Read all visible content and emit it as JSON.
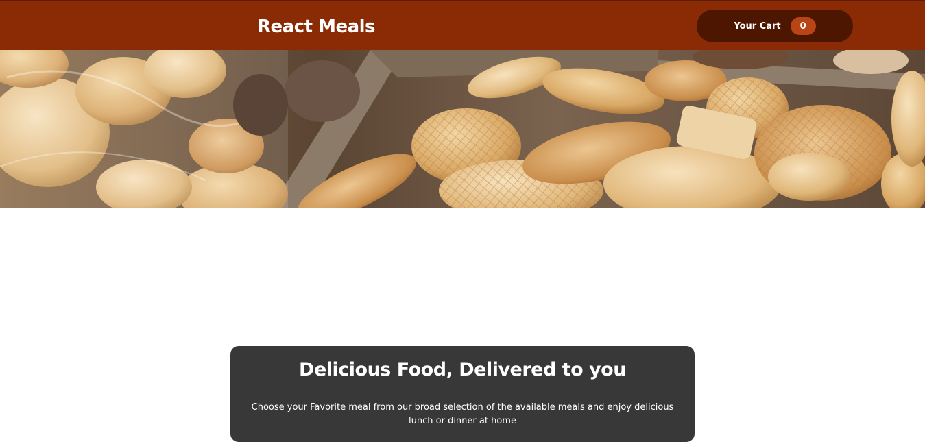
{
  "header": {
    "title": "React Meals",
    "cart_label": "Your Cart",
    "cart_count": "0"
  },
  "hero": {
    "image_icon": "cookies-image"
  },
  "summary": {
    "title": "Delicious Food, Delivered to you",
    "text": "Choose your Favorite meal from our broad selection of the available meals and enjoy delicious lunch or dinner at home"
  },
  "colors": {
    "header_bg": "#8a2b06",
    "cart_button_bg": "#4d1601",
    "badge_bg": "#b94517",
    "summary_bg": "#383838"
  }
}
